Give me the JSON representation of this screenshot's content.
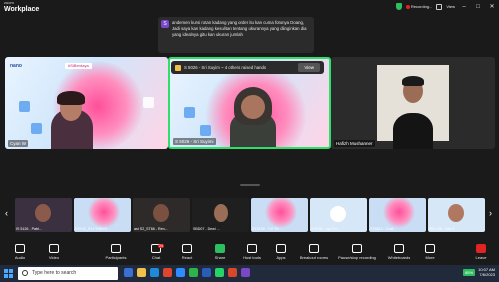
{
  "window": {
    "brand": "zoom",
    "app_name": "Workplace",
    "recording_label": "Recording...",
    "view_label": "View"
  },
  "toast": {
    "avatar_letter": "S",
    "message": "andemen kursi rotan kadang yang order itu kan cuma fotonya Doang, Jadi saya kan kadang kesulitan tentang ukurannya yang diinginkan dia yang idealnya gitu kan ukuran jumlah"
  },
  "share_bar": {
    "text": "S 5026 - Sri Suyim ~ 4 others raised hands",
    "button": "View"
  },
  "tiles": [
    {
      "name": "Cyan W",
      "logo": "nano",
      "banner": "#SiBerdaya"
    },
    {
      "name": "S 5026 - Sri Suyimi"
    },
    {
      "name": "Hafizh Mushanner"
    }
  ],
  "thumbnails": [
    {
      "label": "IS 5126 - Patri..."
    },
    {
      "label": "ES102_S14 SABYA..."
    },
    {
      "label": "ast S2_ST66 - Ren..."
    },
    {
      "label": "SBD07 - Dewi ..."
    },
    {
      "label": "ST5139 - Tri7 Eli..."
    },
    {
      "label": "S 5126 - Lyn Pu..."
    },
    {
      "label": "ST5613 - Gust..."
    },
    {
      "label": "SID 108 - Sisi Y..."
    }
  ],
  "toolbar": {
    "items": [
      {
        "label": "Audio"
      },
      {
        "label": "Video"
      },
      {
        "label": "Participants"
      },
      {
        "label": "Chat",
        "badge": "24"
      },
      {
        "label": "React"
      },
      {
        "label": "Share"
      },
      {
        "label": "Host tools"
      },
      {
        "label": "Apps"
      },
      {
        "label": "Breakout rooms"
      },
      {
        "label": "Pause/stop recording"
      },
      {
        "label": "Whiteboards"
      },
      {
        "label": "More"
      },
      {
        "label": "Leave"
      }
    ]
  },
  "taskbar": {
    "search_placeholder": "Type here to search",
    "battery": "85%",
    "time": "10:07 AM",
    "date": "7/6/2023"
  },
  "colors": {
    "active_speaker_border": "#2de06a",
    "toast_avatar": "#7a47c9",
    "share_green": "#2dbf5f",
    "leave_red": "#e02424"
  }
}
